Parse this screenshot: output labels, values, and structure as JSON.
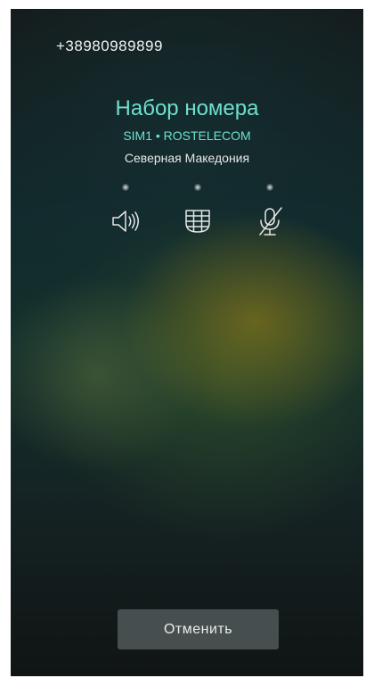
{
  "call": {
    "number": "+38980989899",
    "status": "Набор номера",
    "sim": "SIM1 • ROSTELECOM",
    "region": "Северная Македония"
  },
  "controls": [
    {
      "name": "speaker",
      "icon": "speaker-icon"
    },
    {
      "name": "keypad",
      "icon": "dialpad-icon"
    },
    {
      "name": "mute",
      "icon": "mic-off-icon"
    }
  ],
  "actions": {
    "cancel_label": "Отменить"
  },
  "colors": {
    "accent": "#6fe0cf",
    "text": "#f2f2f2",
    "button_bg": "#586262"
  }
}
